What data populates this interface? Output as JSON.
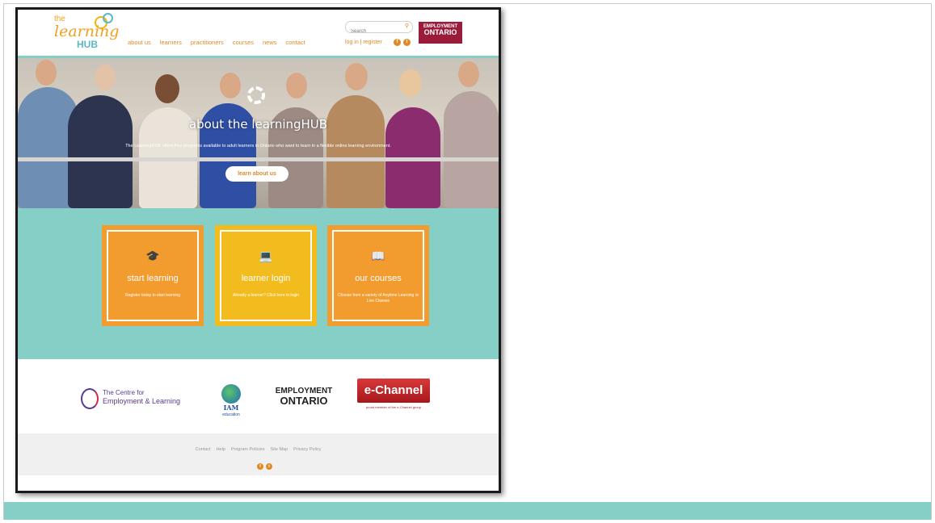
{
  "brand": {
    "logo_the": "the",
    "logo_learning": "learning",
    "logo_hub": "HUB"
  },
  "nav": [
    "about us",
    "learners",
    "practitioners",
    "courses",
    "news",
    "contact"
  ],
  "search": {
    "placeholder": "Search",
    "icon": "search-icon"
  },
  "header": {
    "login_text": "log in | register",
    "social": [
      "facebook-icon",
      "twitter-icon"
    ]
  },
  "employment_ontario": {
    "line1": "EMPLOYMENT",
    "line2": "ONTARIO"
  },
  "hero": {
    "title": "about the learningHUB",
    "subtitle": "The LearningHUB offers free programs available to adult learners in Ontario who want to learn in a flexible online learning environment.",
    "button": "learn about us"
  },
  "tiles": [
    {
      "title": "start learning",
      "subtitle": "Register today to start learning",
      "icon": "graduation-cap-icon",
      "color": "#f29b2e"
    },
    {
      "title": "learner login",
      "subtitle": "Already a learner? Click here to login",
      "icon": "laptop-icon",
      "color": "#f3bc1e"
    },
    {
      "title": "our courses",
      "subtitle": "Choose from a variety of Anytime Learning or Live Classes",
      "icon": "book-icon",
      "color": "#f29b2e"
    }
  ],
  "partners": {
    "centre_line1": "The Centre for",
    "centre_line2": "Employment & Learning",
    "iam_text": "IAM",
    "iam_sub": "education",
    "eo_line1": "EMPLOYMENT",
    "eo_line2": "ONTARIO",
    "echannel": "e-Channel",
    "echannel_sub": "proud member of the e-Channel group"
  },
  "footer": {
    "links": [
      "Contact",
      "Help",
      "Program Policies",
      "Site Map",
      "Privacy Policy"
    ]
  },
  "colors": {
    "accent": "#e08a27",
    "teal": "#86cfc6",
    "eo_red": "#9b1b3b"
  }
}
